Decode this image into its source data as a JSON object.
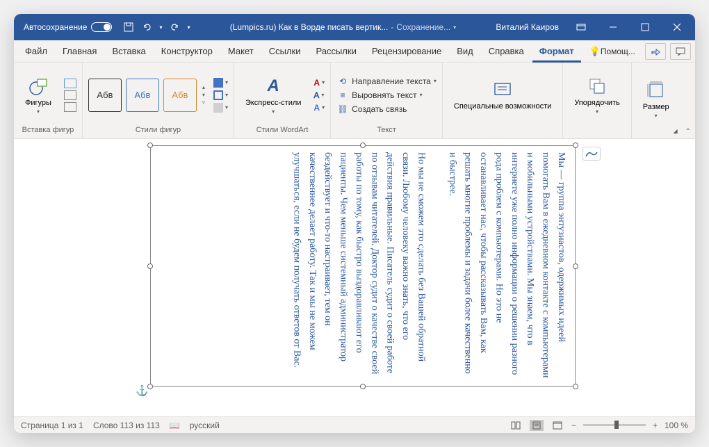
{
  "titlebar": {
    "autosave": "Автосохранение",
    "doc_title": "(Lumpics.ru) Как в Ворде писать вертик...",
    "saving": "Сохранение...",
    "user": "Виталий Каиров"
  },
  "tabs": {
    "file": "Файл",
    "home": "Главная",
    "insert": "Вставка",
    "design": "Конструктор",
    "layout": "Макет",
    "references": "Ссылки",
    "mailings": "Рассылки",
    "review": "Рецензирование",
    "view": "Вид",
    "help": "Справка",
    "format": "Формат",
    "tell_me": "Помощ..."
  },
  "ribbon": {
    "shapes_btn": "Фигуры",
    "shapes_group": "Вставка фигур",
    "style_sample": "Абв",
    "shape_styles_group": "Стили фигур",
    "wordart_btn": "Экспресс-стили",
    "wordart_group": "Стили WordArt",
    "text_direction": "Направление текста",
    "align_text": "Выровнять текст",
    "create_link": "Создать связь",
    "text_group": "Текст",
    "alt_text": "Специальные возможности",
    "arrange": "Упорядочить",
    "size": "Размер"
  },
  "document": {
    "body": "Мы — группа энтузиастов, одержимых идеей помогать Вам в ежедневном контакте с компьютерами и мобильными устройствами. Мы знаем, что в интернете уже полно информации о решении разного рода проблем с компьютерами. Но это не останавливает нас, чтобы рассказывать Вам, как решать многие проблемы и задачи более качественно и быстрее.\n\nНо мы не сможем это сделать без Вашей обратной связи. Любому человеку важно знать, что его действия правильные. Писатель судит о своей работе по отзывам читателей. Доктор судит о качестве своей работы по тому, как быстро выздоравливают его пациенты. Чем меньше системный администратор бездействует и что-то настраивает, тем он качественнее делает работу. Так и мы не можем улучшаться, если не будем получать ответов от Вас."
  },
  "statusbar": {
    "page": "Страница 1 из 1",
    "words": "Слово 113 из 113",
    "lang": "русский",
    "zoom": "100 %"
  }
}
